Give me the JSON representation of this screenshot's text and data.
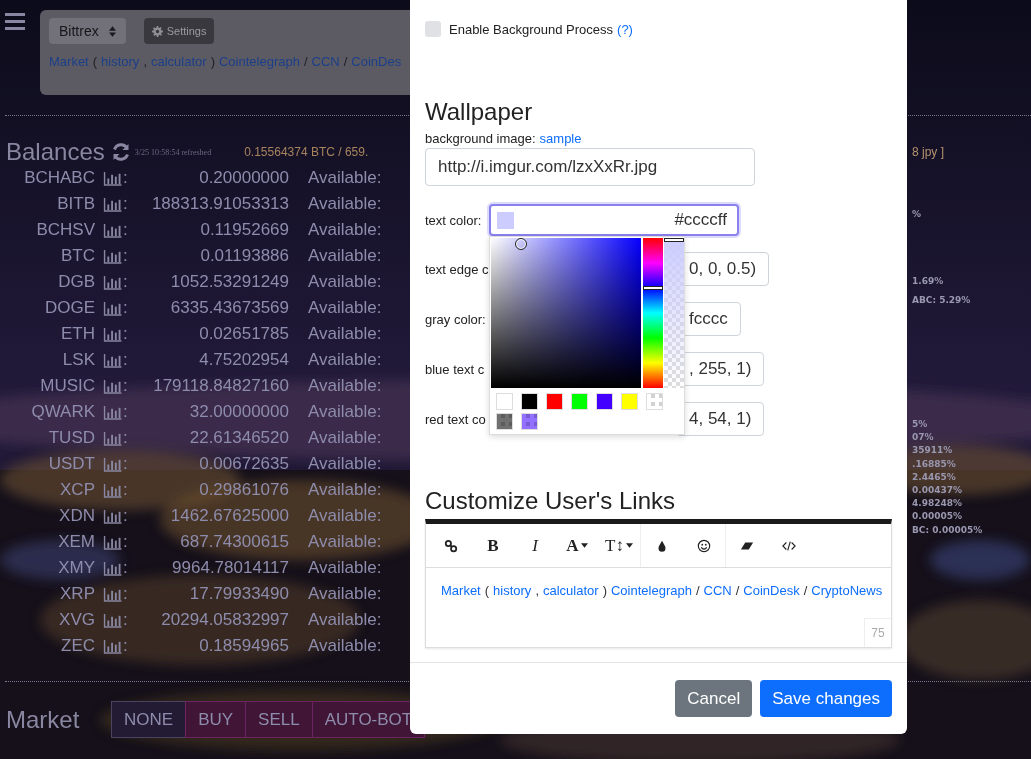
{
  "page": {
    "exchange_select": {
      "value": "Bittrex"
    },
    "settings_button": {
      "label": "Settings"
    },
    "links": [
      {
        "kind": "link",
        "text": "Market"
      },
      {
        "kind": "text",
        "text": "("
      },
      {
        "kind": "link",
        "text": "history"
      },
      {
        "kind": "text",
        "text": ","
      },
      {
        "kind": "link",
        "text": "calculator"
      },
      {
        "kind": "text",
        "text": ")"
      },
      {
        "kind": "link",
        "text": "Cointelegraph"
      },
      {
        "kind": "text",
        "text": "/"
      },
      {
        "kind": "link",
        "text": "CCN"
      },
      {
        "kind": "text",
        "text": "/"
      },
      {
        "kind": "link",
        "text": "CoinDes"
      }
    ],
    "balances": {
      "title": "Balances",
      "refreshed": "3/25 10:58:54 refreshed",
      "total": "0.15564374 BTC / 659.",
      "total_tail": "8 jpy ]",
      "rows": [
        {
          "coin": "BCHABC",
          "suffix": ":",
          "amount": "0.20000000",
          "available_label": "Available:"
        },
        {
          "coin": "BITB",
          "suffix": ":",
          "amount": "188313.91053313",
          "available_label": "Available:"
        },
        {
          "coin": "BCHSV",
          "suffix": ":",
          "amount": "0.11952669",
          "available_label": "Available:"
        },
        {
          "coin": "BTC",
          "suffix": ":",
          "amount": "0.01193886",
          "available_label": "Available:"
        },
        {
          "coin": "DGB",
          "suffix": ":",
          "amount": "1052.53291249",
          "available_label": "Available:"
        },
        {
          "coin": "DOGE",
          "suffix": ":",
          "amount": "6335.43673569",
          "available_label": "Available:"
        },
        {
          "coin": "ETH",
          "suffix": ":",
          "amount": "0.02651785",
          "available_label": "Available:"
        },
        {
          "coin": "LSK",
          "suffix": ":",
          "amount": "4.75202954",
          "available_label": "Available:"
        },
        {
          "coin": "MUSIC",
          "suffix": ":",
          "amount": "179118.84827160",
          "available_label": "Available:"
        },
        {
          "coin": "QWARK",
          "suffix": ":",
          "amount": "32.00000000",
          "available_label": "Available:"
        },
        {
          "coin": "TUSD",
          "suffix": ":",
          "amount": "22.61346520",
          "available_label": "Available:"
        },
        {
          "coin": "USDT",
          "suffix": ":",
          "amount": "0.00672635",
          "available_label": "Available:"
        },
        {
          "coin": "XCP",
          "suffix": ":",
          "amount": "0.29861076",
          "available_label": "Available:"
        },
        {
          "coin": "XDN",
          "suffix": ":",
          "amount": "1462.67625000",
          "available_label": "Available:"
        },
        {
          "coin": "XEM",
          "suffix": ":",
          "amount": "687.74300615",
          "available_label": "Available:"
        },
        {
          "coin": "XMY",
          "suffix": ":",
          "amount": "9964.78014117",
          "available_label": "Available:"
        },
        {
          "coin": "XRP",
          "suffix": ":",
          "amount": "17.79933490",
          "available_label": "Available:"
        },
        {
          "coin": "XVG",
          "suffix": ":",
          "amount": "20294.05832997",
          "available_label": "Available:"
        },
        {
          "coin": "ZEC",
          "suffix": ":",
          "amount": "0.18594965",
          "available_label": "Available:"
        }
      ]
    },
    "side_groups": [
      [
        "%"
      ],
      [
        "1.69%",
        "ABC: 5.29%"
      ],
      [
        "5%",
        "07%",
        "35911%",
        ".16885%",
        "2.4465%",
        "0.00437%",
        "4.98248%",
        "0.00005%",
        "BC: 0.00005%"
      ]
    ],
    "market": {
      "title": "Market",
      "modes": [
        {
          "label": "NONE",
          "selected": true
        },
        {
          "label": "BUY",
          "selected": false
        },
        {
          "label": "SELL",
          "selected": false
        },
        {
          "label": "AUTO-BOT",
          "selected": false
        }
      ]
    }
  },
  "modal": {
    "system": {
      "checkbox": {
        "label": "Enable Background Process",
        "help": "(?)",
        "checked": false
      }
    },
    "wallpaper": {
      "title": "Wallpaper",
      "background_image": {
        "label": "background image:",
        "link": "sample",
        "value": "http://i.imgur.com/lzxXxRr.jpg"
      },
      "text_color": {
        "label": "text color:",
        "value": "#ccccff",
        "focused": true
      },
      "color_rows": [
        {
          "label": "text edge c",
          "value": "0, 0, 0.5)"
        },
        {
          "label": "gray color:",
          "value": "fcccc"
        },
        {
          "label": "blue text c",
          "value": ", 255, 1)"
        },
        {
          "label": "red text co",
          "value": "4, 54, 1)"
        }
      ],
      "hue_slider": {
        "level": 0.67
      },
      "alpha_slider": {
        "level": 1
      },
      "swatches": [
        {
          "kind": "solid",
          "color": "#ffffff"
        },
        {
          "kind": "solid",
          "color": "#000000"
        },
        {
          "kind": "solid",
          "color": "#ff0000"
        },
        {
          "kind": "solid",
          "color": "#00ff00"
        },
        {
          "kind": "solid",
          "color": "#4400ff"
        },
        {
          "kind": "solid",
          "color": "#ffff00"
        },
        {
          "kind": "checker",
          "color": "#ffffff"
        },
        {
          "kind": "checker",
          "color": "#707070"
        },
        {
          "kind": "checker",
          "color": "#9370ff"
        }
      ]
    },
    "links_editor": {
      "title": "Customize User's Links",
      "toolbar": [
        [
          {
            "kind": "link"
          },
          {
            "kind": "bold",
            "label": "B"
          },
          {
            "kind": "italic",
            "label": "I"
          },
          {
            "kind": "font-color",
            "label": "A"
          },
          {
            "kind": "font-size",
            "label": "T↕"
          }
        ],
        [
          {
            "kind": "droplet"
          },
          {
            "kind": "smiley"
          }
        ],
        [
          {
            "kind": "eraser"
          },
          {
            "kind": "code"
          }
        ]
      ],
      "links": [
        {
          "kind": "link",
          "text": "Market"
        },
        {
          "kind": "text",
          "text": "("
        },
        {
          "kind": "link",
          "text": "history"
        },
        {
          "kind": "text",
          "text": ","
        },
        {
          "kind": "link",
          "text": "calculator"
        },
        {
          "kind": "text",
          "text": ")"
        },
        {
          "kind": "link",
          "text": "Cointelegraph"
        },
        {
          "kind": "text",
          "text": "/"
        },
        {
          "kind": "link",
          "text": "CCN"
        },
        {
          "kind": "text",
          "text": "/"
        },
        {
          "kind": "link",
          "text": "CoinDesk"
        },
        {
          "kind": "text",
          "text": "/"
        },
        {
          "kind": "link",
          "text": "CryptoNews"
        }
      ],
      "counter": "75"
    },
    "buttons": [
      {
        "label": "Cancel",
        "kind": "secondary"
      },
      {
        "label": "Save changes",
        "kind": "primary"
      }
    ]
  }
}
